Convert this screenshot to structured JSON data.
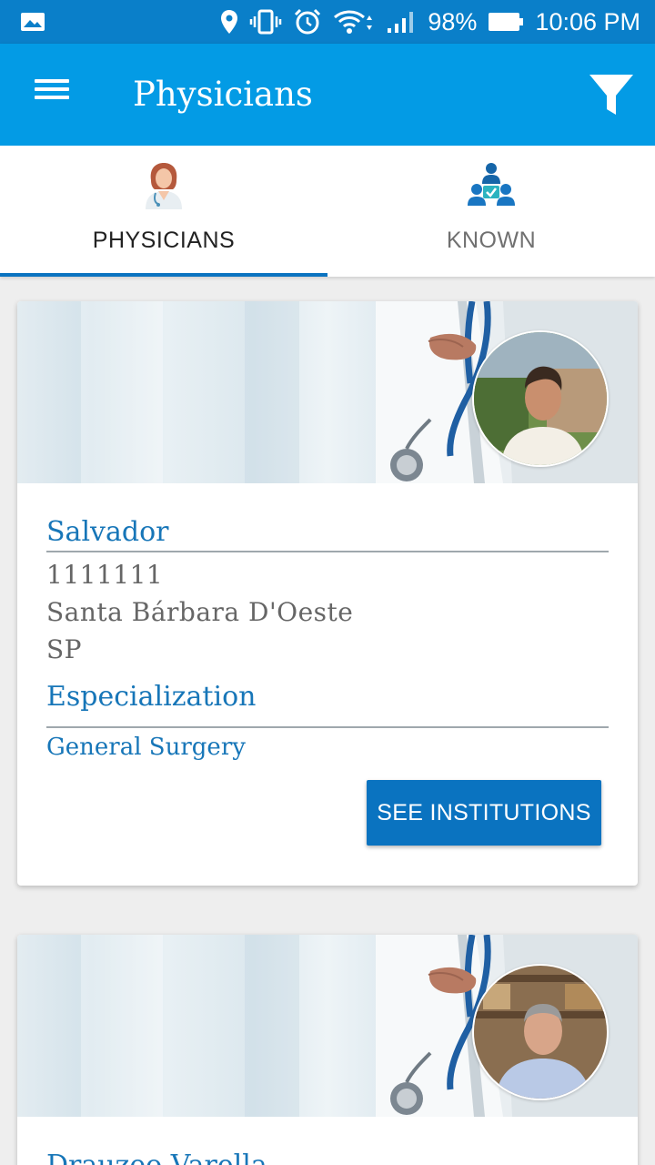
{
  "status_bar": {
    "battery": "98%",
    "time": "10:06 PM",
    "icons": [
      "gallery-icon",
      "location-icon",
      "vibrate-icon",
      "alarm-icon",
      "wifi-icon",
      "signal-icon",
      "battery-icon"
    ]
  },
  "app_bar": {
    "title": "Physicians",
    "icons": [
      "menu-icon",
      "filter-icon"
    ]
  },
  "tabs": [
    {
      "label": "PHYSICIANS",
      "icon": "physician-icon",
      "active": true
    },
    {
      "label": "KNOWN",
      "icon": "network-icon",
      "active": false
    }
  ],
  "physicians": [
    {
      "name": "Salvador",
      "id": "1111111",
      "city": "Santa Bárbara D'Oeste",
      "state": "SP",
      "specialization_label": "Especialization",
      "specialization": "General Surgery",
      "button_label": "SEE INSTITUTIONS"
    },
    {
      "name": "Drauzeo Varella"
    }
  ],
  "colors": {
    "status_bar": "#0a7fc9",
    "app_bar": "#039be5",
    "accent": "#0a73c0",
    "link_text": "#1776b8"
  }
}
